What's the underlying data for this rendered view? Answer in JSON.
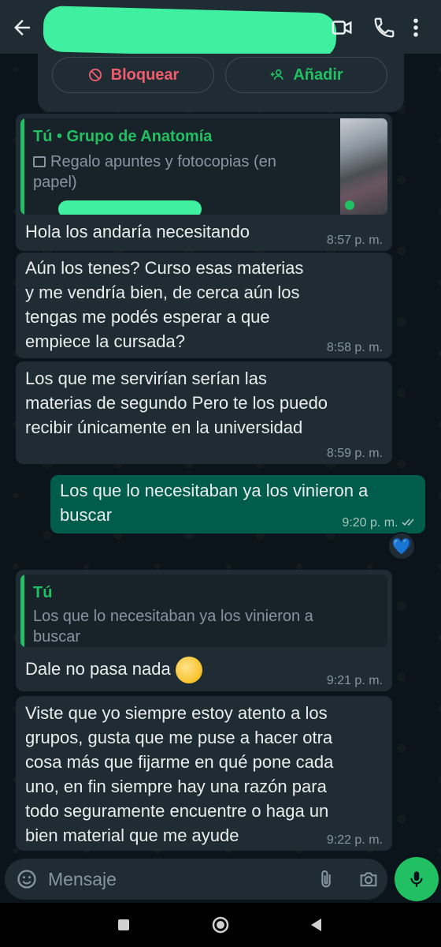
{
  "header": {
    "back_icon": "arrow-left-icon",
    "actions": [
      "video-call-icon",
      "phone-icon",
      "more-vert-icon"
    ]
  },
  "contact_actions": {
    "block_label": "Bloquear",
    "add_label": "Añadir"
  },
  "messages": [
    {
      "direction": "in",
      "quote": {
        "name": "Tú • Grupo de Anatomía",
        "text": "Regalo apuntes y fotocopias (en papel)",
        "has_image": true
      },
      "text": "Hola los andaría necesitando",
      "time": "8:57 p. m."
    },
    {
      "direction": "in",
      "lines": [
        "Aún los tenes? Curso esas materias",
        "y me vendría bien, de cerca aún los",
        "tengas me podés esperar a que",
        "empiece la cursada?"
      ],
      "time": "8:58 p. m."
    },
    {
      "direction": "in",
      "lines": [
        "Los que me servirían serían las",
        "materias de segundo Pero te los puedo",
        "recibir únicamente en la universidad"
      ],
      "time": "8:59 p. m."
    },
    {
      "direction": "out",
      "lines": [
        "Los que lo necesitaban ya los vinieron a",
        "buscar"
      ],
      "time": "9:20 p. m.",
      "reaction": "💙"
    },
    {
      "direction": "in",
      "quote": {
        "name": "Tú",
        "lines": [
          "Los que lo necesitaban ya los vinieron a",
          "buscar"
        ]
      },
      "text": "Dale no pasa nada",
      "emoji": "😢",
      "time": "9:21 p. m."
    },
    {
      "direction": "in",
      "lines": [
        "Viste que yo siempre estoy atento a los",
        "grupos, gusta que me puse a hacer otra",
        "cosa más que fijarme en qué pone cada",
        "uno, en fin siempre hay una razón para",
        "todo seguramente encuentre o haga un",
        "bien material que me ayude"
      ],
      "time": "9:22 p. m."
    }
  ],
  "composer": {
    "placeholder": "Mensaje",
    "icons": [
      "sticker-icon",
      "attach-icon",
      "camera-icon",
      "mic-icon"
    ]
  },
  "colors": {
    "background": "#0b141a",
    "incoming": "#1f2c34",
    "outgoing": "#005c4b",
    "accent": "#21c063",
    "danger": "#f15c6d"
  }
}
